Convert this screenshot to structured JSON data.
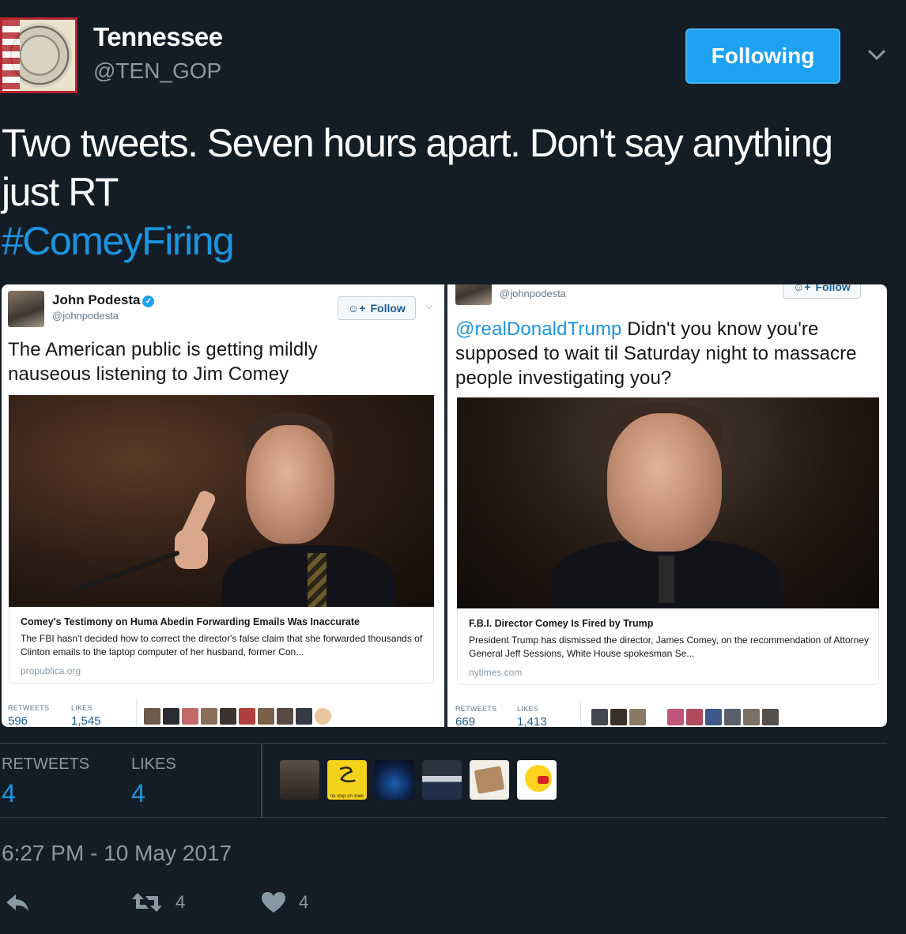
{
  "author": {
    "display_name": "Tennessee",
    "handle": "@TEN_GOP",
    "follow_label": "Following"
  },
  "tweet": {
    "text": "Two tweets. Seven hours apart. Don't say anything just RT",
    "hashtag": "#ComeyFiring"
  },
  "embedded": {
    "left": {
      "name": "John Podesta",
      "handle": "@johnpodesta",
      "follow_label": "Follow",
      "text": "The American public is getting mildly nauseous listening to Jim Comey",
      "card_title": "Comey's Testimony on Huma Abedin Forwarding Emails Was Inaccurate",
      "card_desc": "The FBI hasn't decided how to correct the director's false claim that she forwarded thousands of Clinton emails to the laptop computer of her husband, former Con...",
      "card_domain": "propublica.org",
      "retweets_label": "RETWEETS",
      "retweets": "596",
      "likes_label": "LIKES",
      "likes": "1,545"
    },
    "right": {
      "handle": "@johnpodesta",
      "follow_label": "Follow",
      "mention": "@realDonaldTrump",
      "text": "Didn't you know you're supposed to wait til Saturday night to massacre people investigating you?",
      "card_title": "F.B.I. Director Comey Is Fired by Trump",
      "card_desc": "President Trump has dismissed the director, James Comey, on the recommendation of Attorney General Jeff Sessions, White House spokesman Se...",
      "card_domain": "nytimes.com",
      "retweets_label": "RETWEETS",
      "retweets": "669",
      "likes_label": "LIKES",
      "likes": "1,413"
    }
  },
  "stats": {
    "retweets_label": "RETWEETS",
    "retweets": "4",
    "likes_label": "LIKES",
    "likes": "4",
    "liker_caption": "no step on snek"
  },
  "timestamp": "6:27 PM - 10 May 2017",
  "actions": {
    "reply_icon": "reply-icon",
    "retweet_icon": "retweet-icon",
    "retweet_count": "4",
    "like_icon": "heart-icon",
    "like_count": "4"
  },
  "colors": {
    "background": "#141d26",
    "accent": "#1da1f2",
    "link": "#1b95e0",
    "muted": "#8899a6"
  }
}
